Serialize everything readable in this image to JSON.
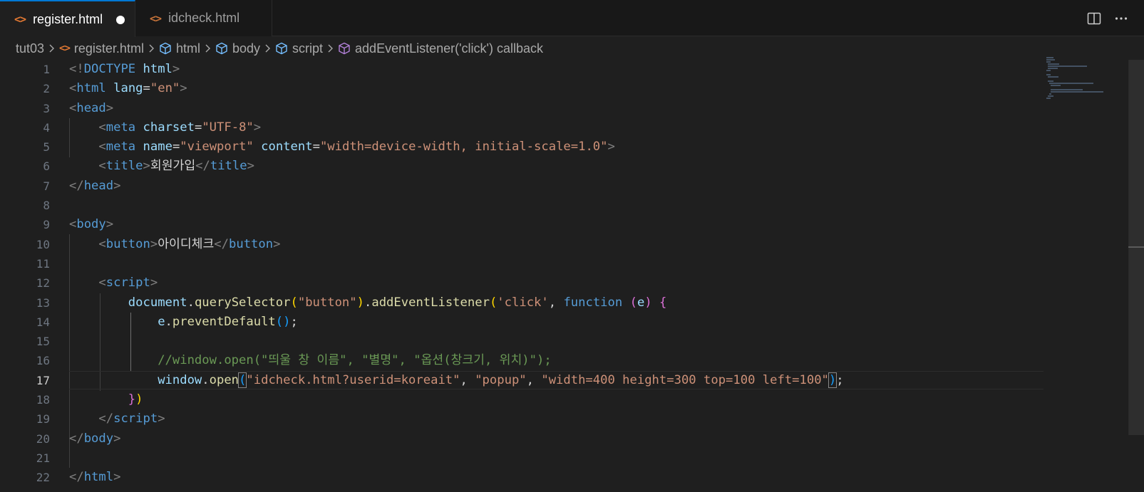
{
  "tabs": [
    {
      "label": "register.html",
      "icon": "html-file-icon",
      "active": true,
      "dirty": true
    },
    {
      "label": "idcheck.html",
      "icon": "html-file-icon",
      "active": false,
      "dirty": false
    }
  ],
  "tab_actions": [
    {
      "icon": "split-editor-icon"
    },
    {
      "icon": "more-actions-icon"
    }
  ],
  "breadcrumb": {
    "folder": "tut03",
    "file": "register.html",
    "symbols": [
      "html",
      "body",
      "script",
      "addEventListener('click') callback"
    ]
  },
  "editor": {
    "current_line": 17,
    "line_numbers": [
      "1",
      "2",
      "3",
      "4",
      "5",
      "6",
      "7",
      "8",
      "9",
      "10",
      "11",
      "12",
      "13",
      "14",
      "15",
      "16",
      "17",
      "18",
      "19",
      "20",
      "21",
      "22"
    ],
    "lines": [
      [
        [
          "t-punct",
          "<!"
        ],
        [
          "t-tag",
          "DOCTYPE"
        ],
        [
          "t-text",
          " "
        ],
        [
          "t-attr",
          "html"
        ],
        [
          "t-punct",
          ">"
        ]
      ],
      [
        [
          "t-punct",
          "<"
        ],
        [
          "t-tag",
          "html"
        ],
        [
          "t-text",
          " "
        ],
        [
          "t-attr",
          "lang"
        ],
        [
          "t-text",
          "="
        ],
        [
          "t-str",
          "\"en\""
        ],
        [
          "t-punct",
          ">"
        ]
      ],
      [
        [
          "t-punct",
          "<"
        ],
        [
          "t-tag",
          "head"
        ],
        [
          "t-punct",
          ">"
        ]
      ],
      [
        [
          "t-text",
          "    "
        ],
        [
          "t-punct",
          "<"
        ],
        [
          "t-tag",
          "meta"
        ],
        [
          "t-text",
          " "
        ],
        [
          "t-attr",
          "charset"
        ],
        [
          "t-text",
          "="
        ],
        [
          "t-str",
          "\"UTF-8\""
        ],
        [
          "t-punct",
          ">"
        ]
      ],
      [
        [
          "t-text",
          "    "
        ],
        [
          "t-punct",
          "<"
        ],
        [
          "t-tag",
          "meta"
        ],
        [
          "t-text",
          " "
        ],
        [
          "t-attr",
          "name"
        ],
        [
          "t-text",
          "="
        ],
        [
          "t-str",
          "\"viewport\""
        ],
        [
          "t-text",
          " "
        ],
        [
          "t-attr",
          "content"
        ],
        [
          "t-text",
          "="
        ],
        [
          "t-str",
          "\"width=device-width, initial-scale=1.0\""
        ],
        [
          "t-punct",
          ">"
        ]
      ],
      [
        [
          "t-text",
          "    "
        ],
        [
          "t-punct",
          "<"
        ],
        [
          "t-tag",
          "title"
        ],
        [
          "t-punct",
          ">"
        ],
        [
          "t-text",
          "회원가입"
        ],
        [
          "t-punct",
          "</"
        ],
        [
          "t-tag",
          "title"
        ],
        [
          "t-punct",
          ">"
        ]
      ],
      [
        [
          "t-punct",
          "</"
        ],
        [
          "t-tag",
          "head"
        ],
        [
          "t-punct",
          ">"
        ]
      ],
      [],
      [
        [
          "t-punct",
          "<"
        ],
        [
          "t-tag",
          "body"
        ],
        [
          "t-punct",
          ">"
        ]
      ],
      [
        [
          "t-text",
          "    "
        ],
        [
          "t-punct",
          "<"
        ],
        [
          "t-tag",
          "button"
        ],
        [
          "t-punct",
          ">"
        ],
        [
          "t-text",
          "아이디체크"
        ],
        [
          "t-punct",
          "</"
        ],
        [
          "t-tag",
          "button"
        ],
        [
          "t-punct",
          ">"
        ]
      ],
      [],
      [
        [
          "t-text",
          "    "
        ],
        [
          "t-punct",
          "<"
        ],
        [
          "t-tag",
          "script"
        ],
        [
          "t-punct",
          ">"
        ]
      ],
      [
        [
          "t-text",
          "        "
        ],
        [
          "t-var",
          "document"
        ],
        [
          "t-text",
          "."
        ],
        [
          "t-fn",
          "querySelector"
        ],
        [
          "t-br1",
          "("
        ],
        [
          "t-str",
          "\"button\""
        ],
        [
          "t-br1",
          ")"
        ],
        [
          "t-text",
          "."
        ],
        [
          "t-fn",
          "addEventListener"
        ],
        [
          "t-br1",
          "("
        ],
        [
          "t-str",
          "'click'"
        ],
        [
          "t-text",
          ", "
        ],
        [
          "t-kw",
          "function"
        ],
        [
          "t-text",
          " "
        ],
        [
          "t-br2",
          "("
        ],
        [
          "t-var",
          "e"
        ],
        [
          "t-br2",
          ")"
        ],
        [
          "t-text",
          " "
        ],
        [
          "t-br2",
          "{"
        ]
      ],
      [
        [
          "t-text",
          "            "
        ],
        [
          "t-var",
          "e"
        ],
        [
          "t-text",
          "."
        ],
        [
          "t-fn",
          "preventDefault"
        ],
        [
          "t-br3",
          "()"
        ],
        [
          "t-text",
          ";"
        ]
      ],
      [],
      [
        [
          "t-text",
          "            "
        ],
        [
          "t-comment",
          "//window.open(\"띄울 창 이름\", \"별명\", \"옵션(창크기, 위치)\");"
        ]
      ],
      [
        [
          "t-text",
          "            "
        ],
        [
          "t-var",
          "window"
        ],
        [
          "t-text",
          "."
        ],
        [
          "t-fn",
          "open"
        ],
        [
          "t-br3 cursor-br",
          "("
        ],
        [
          "t-str",
          "\"idcheck.html?userid=koreait\""
        ],
        [
          "t-text",
          ", "
        ],
        [
          "t-str",
          "\"popup\""
        ],
        [
          "t-text",
          ", "
        ],
        [
          "t-str",
          "\"width=400 height=300 top=100 left=100\""
        ],
        [
          "t-br3 cursor-br",
          ")"
        ],
        [
          "t-text",
          ";"
        ]
      ],
      [
        [
          "t-text",
          "        "
        ],
        [
          "t-br2",
          "}"
        ],
        [
          "t-br1",
          ")"
        ]
      ],
      [
        [
          "t-text",
          "    "
        ],
        [
          "t-punct",
          "</"
        ],
        [
          "t-tag",
          "script"
        ],
        [
          "t-punct",
          ">"
        ]
      ],
      [
        [
          "t-punct",
          "</"
        ],
        [
          "t-tag",
          "body"
        ],
        [
          "t-punct",
          ">"
        ]
      ],
      [],
      [
        [
          "t-punct",
          "</"
        ],
        [
          "t-tag",
          "html"
        ],
        [
          "t-punct",
          ">"
        ]
      ]
    ]
  },
  "colors": {
    "accent": "#0078d4",
    "editor_bg": "#1f1f1f",
    "tab_bar_bg": "#181818",
    "html_icon": "#e37933",
    "symbol_icon": "#75beff",
    "method_icon": "#b180d7"
  }
}
